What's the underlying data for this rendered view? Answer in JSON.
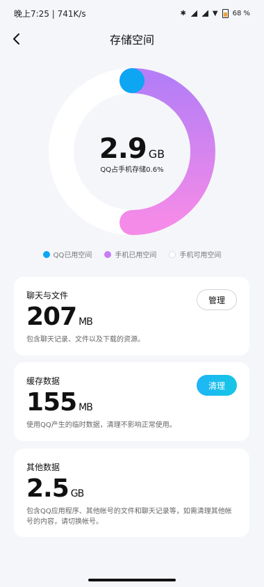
{
  "status": {
    "time_speed": "晚上7:25 | 741K/s",
    "battery": "68"
  },
  "header": {
    "title": "存储空间"
  },
  "summary": {
    "value": "2.9",
    "unit": "GB",
    "subtitle": "QQ占手机存储0.6%"
  },
  "legend": [
    {
      "label": "QQ已用空间",
      "color": "#0ea5f3"
    },
    {
      "label": "手机已用空间",
      "color": "#c77df5"
    },
    {
      "label": "手机可用空间",
      "color": "#ffffff"
    }
  ],
  "cards": [
    {
      "title": "聊天与文件",
      "value": "207",
      "unit": "MB",
      "desc": "包含聊天记录、文件以及下载的资源。",
      "button": "管理"
    },
    {
      "title": "缓存数据",
      "value": "155",
      "unit": "MB",
      "desc": "使用QQ产生的临时数据，清理不影响正常使用。",
      "button": "清理"
    },
    {
      "title": "其他数据",
      "value": "2.5",
      "unit": "GB",
      "desc": "包含QQ应用程序、其他帐号的文件和聊天记录等，如需清理其他帐号的内容，请切换帐号。"
    }
  ],
  "icons": {
    "back": "chevron-left-icon"
  }
}
